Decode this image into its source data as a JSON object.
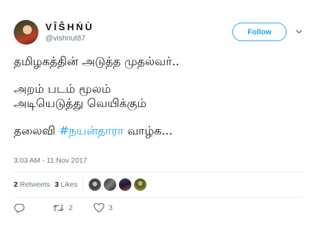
{
  "user": {
    "display_name": "VÎŜHŃÙ",
    "handle": "@vishnut87"
  },
  "follow_label": "Follow",
  "tweet_lines": [
    "தமிழகத்தின் அடுத்த முதல்வர்..",
    "அறம் படம் மூலம்",
    "அடியெடுத்து வெயிக்கும்"
  ],
  "last_line": {
    "before": "தலைவி ",
    "hashtag": "#நயன்தாரா",
    "after": " வாழ்க..."
  },
  "timestamp": "3:03 AM - 11 Nov 2017",
  "stats": {
    "retweets_count": "2",
    "retweets_label": "Retweets",
    "likes_count": "3",
    "likes_label": "Likes"
  },
  "actions": {
    "reply_count": "",
    "retweet_count": "2",
    "like_count": "3"
  },
  "colors": {
    "accent": "#1da1f2",
    "secondary_text": "#657786",
    "divider": "#e6ecf0"
  },
  "icons": [
    "chevron-down-icon",
    "reply-icon",
    "retweet-icon",
    "heart-icon"
  ]
}
